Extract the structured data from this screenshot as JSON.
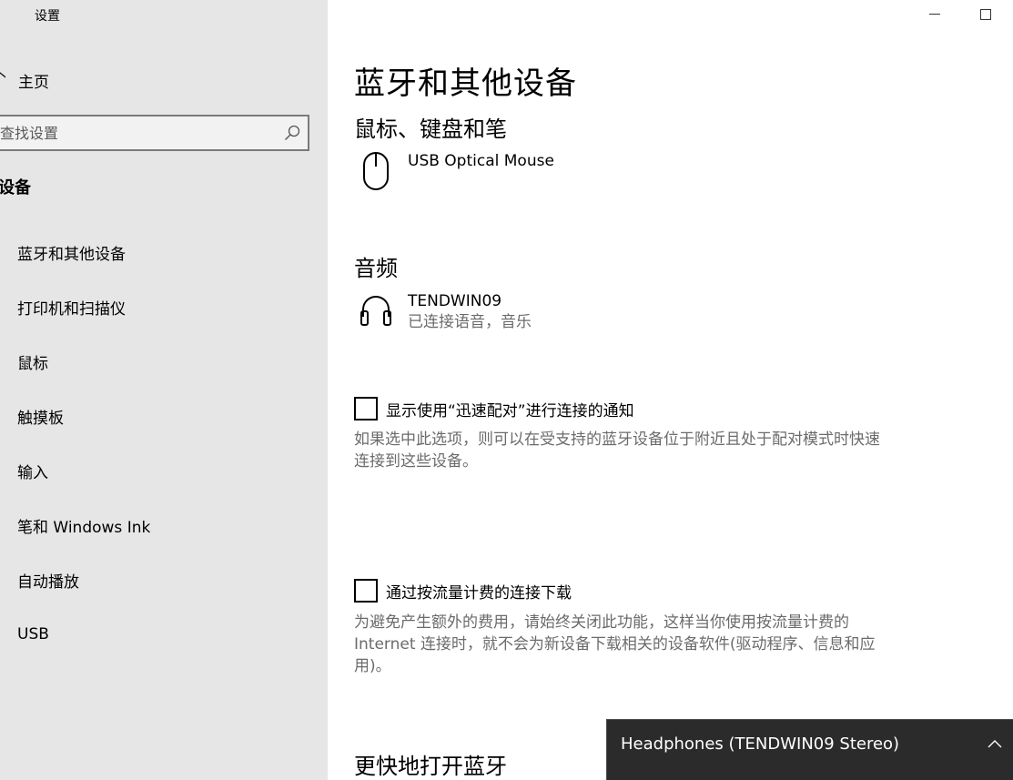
{
  "app": {
    "title": "设置"
  },
  "sidebar": {
    "home_label": "主页",
    "search_placeholder": "查找设置",
    "section_label": "设备",
    "items": [
      {
        "label": "蓝牙和其他设备"
      },
      {
        "label": "打印机和扫描仪"
      },
      {
        "label": "鼠标"
      },
      {
        "label": "触摸板"
      },
      {
        "label": "输入"
      },
      {
        "label": "笔和 Windows Ink"
      },
      {
        "label": "自动播放"
      },
      {
        "label": "USB"
      }
    ]
  },
  "main": {
    "title": "蓝牙和其他设备",
    "groups": {
      "mouse": {
        "title": "鼠标、键盘和笔",
        "device_name": "USB Optical Mouse",
        "icon": "mouse-icon"
      },
      "audio": {
        "title": "音频",
        "device_name": "TENDWIN09",
        "device_status": "已连接语音，音乐",
        "icon": "headphones-icon"
      }
    },
    "swift_pair": {
      "label": "显示使用“迅速配对”进行连接的通知",
      "checked": false,
      "desc": "如果选中此选项，则可以在受支持的蓝牙设备位于附近且处于配对模式时快速连接到这些设备。"
    },
    "metered": {
      "label": "通过按流量计费的连接下载",
      "checked": false,
      "desc": "为避免产生额外的费用，请始终关闭此功能，这样当你使用按流量计费的 Internet 连接时，就不会为新设备下载相关的设备软件(驱动程序、信息和应用)。"
    },
    "faster_title": "更快地打开蓝牙"
  },
  "toast": {
    "text": "Headphones (TENDWIN09 Stereo)",
    "icon": "chevron-up-icon"
  },
  "colors": {
    "sidebar_bg": "#e6e6e6",
    "toast_bg": "#2b2b2b",
    "secondary_text": "#6b6b6b"
  }
}
